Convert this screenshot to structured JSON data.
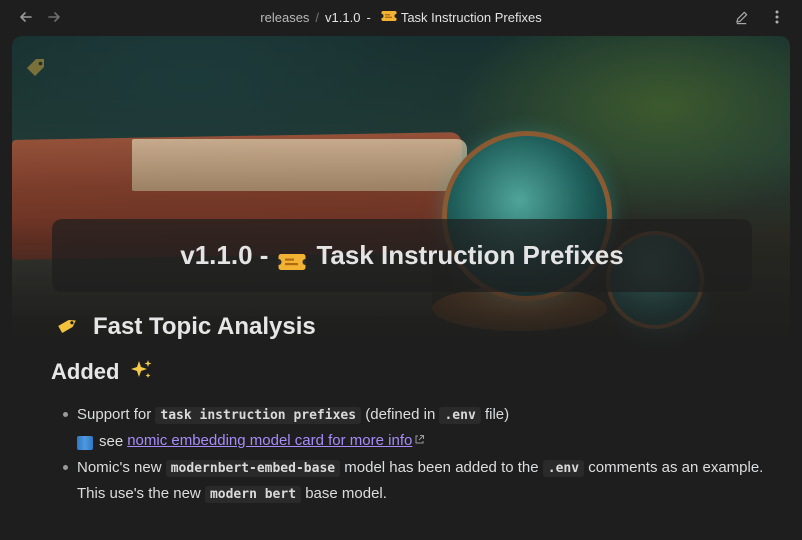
{
  "nav": {
    "back_icon": "arrow-left-icon",
    "forward_icon": "arrow-right-icon"
  },
  "breadcrumb": {
    "folder": "releases",
    "separator": "/",
    "current": "v1.1.0",
    "dash": "-",
    "emoji_icon": "ticket-icon",
    "current_title": "Task Instruction Prefixes"
  },
  "actions": {
    "edit_icon": "pencil-icon",
    "more_icon": "more-vertical-icon"
  },
  "banner": {
    "tag_icon": "tag-icon",
    "title_prefix": "v1.1.0 -",
    "title_icon": "ticket-icon",
    "title_text": "Task Instruction Prefixes"
  },
  "content": {
    "heading1_icon": "label-tag-icon",
    "heading1": "Fast Topic Analysis",
    "heading2": "Added",
    "heading2_icon": "sparkles-icon",
    "items": [
      {
        "text_before": "Support for",
        "code1": "task instruction prefixes",
        "text_middle": "(defined in",
        "code2": ".env",
        "text_after": "file)",
        "sub_icon": "blue-book-icon",
        "sub_text": "see",
        "link_text": "nomic embedding model card for more info",
        "link_icon": "external-link-icon"
      },
      {
        "text_before": "Nomic's new",
        "code1": "modernbert-embed-base",
        "text_middle": "model has been added to the",
        "code2": ".env",
        "text_after": "comments as an example. This use's the new",
        "code3": "modern bert",
        "text_end": "base model."
      }
    ]
  },
  "colors": {
    "background": "#1e1e1e",
    "link": "#a78bfa",
    "text": "#dcddde"
  }
}
